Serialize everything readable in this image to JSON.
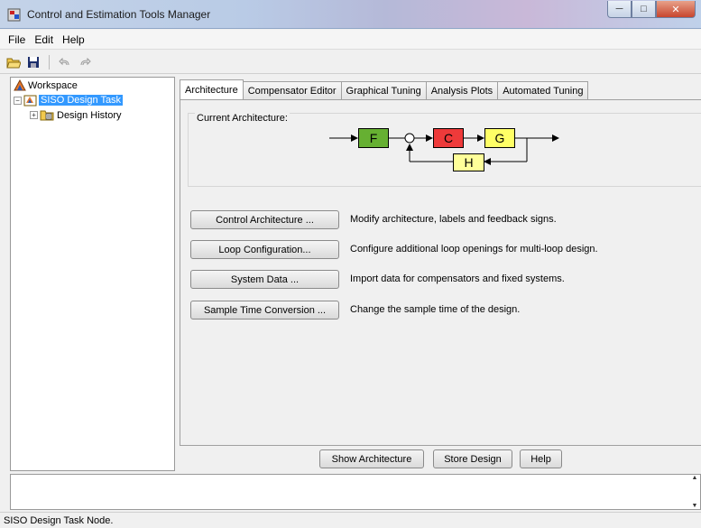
{
  "window": {
    "title": "Control and Estimation Tools Manager"
  },
  "menu": {
    "items": [
      "File",
      "Edit",
      "Help"
    ]
  },
  "toolbar": {
    "icons": [
      "open-folder-icon",
      "save-icon",
      "undo-icon",
      "redo-icon"
    ]
  },
  "tree": {
    "root": "Workspace",
    "task": "SISO Design Task",
    "history": "Design History"
  },
  "tabs": [
    {
      "label": "Architecture"
    },
    {
      "label": "Compensator Editor"
    },
    {
      "label": "Graphical Tuning"
    },
    {
      "label": "Analysis Plots"
    },
    {
      "label": "Automated Tuning"
    }
  ],
  "architecture": {
    "group_label": "Current Architecture:",
    "blocks": {
      "f": "F",
      "c": "C",
      "g": "G",
      "h": "H"
    },
    "colors": {
      "f": "#66b032",
      "c": "#ee3a3a",
      "g": "#ffff66",
      "h": "#ffff99"
    }
  },
  "actions": [
    {
      "button": "Control Architecture ...",
      "description": "Modify architecture, labels and feedback signs."
    },
    {
      "button": "Loop Configuration...",
      "description": "Configure additional loop openings for multi-loop design."
    },
    {
      "button": "System Data ...",
      "description": "Import data for compensators and fixed systems."
    },
    {
      "button": "Sample Time Conversion ...",
      "description": "Change the sample time of the design."
    }
  ],
  "bottom_buttons": {
    "show": "Show Architecture",
    "store": "Store Design",
    "help": "Help"
  },
  "status": {
    "text": "SISO Design Task Node."
  }
}
